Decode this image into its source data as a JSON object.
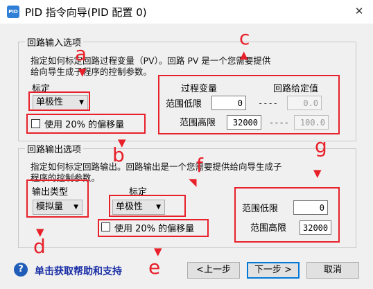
{
  "window": {
    "title": "PID 指令向导(PID 配置 0)",
    "app_icon_text": "PID",
    "close_glyph": "✕"
  },
  "input_section": {
    "title": "回路输入选项",
    "description_line1": "指定如何标定回路过程变量（PV）。回路 PV 是一个您需要提供",
    "description_line2": "给向导生成子程序的控制参数。",
    "scale_label": "标定",
    "scale_value": "单极性",
    "offset_checkbox_label": "使用 20% 的偏移量",
    "offset_checked": false,
    "pv_header": "过程变量",
    "setpoint_header": "回路给定值",
    "low_label": "范围低限",
    "high_label": "范围高限",
    "pv_low": "0",
    "pv_high": "32000",
    "sp_low": "0.0",
    "sp_high": "100.0",
    "dash_sep": "----"
  },
  "output_section": {
    "title": "回路输出选项",
    "description_line1": "指定如何标定回路输出。回路输出是一个您需要提供给向导生成子",
    "description_line2": "程序的控制参数。",
    "type_label": "输出类型",
    "type_value": "模拟量",
    "scale_label": "标定",
    "scale_value": "单极性",
    "offset_checkbox_label": "使用 20% 的偏移量",
    "offset_checked": false,
    "low_label": "范围低限",
    "high_label": "范围高限",
    "low_value": "0",
    "high_value": "32000"
  },
  "annotations": {
    "a": "a",
    "b": "b",
    "c": "c",
    "d": "d",
    "e": "e",
    "f": "f",
    "g": "g"
  },
  "footer": {
    "help_icon_text": "?",
    "help_link": "单击获取帮助和支持",
    "prev_button": "<上一步",
    "next_button": "下一步 >",
    "cancel_button": "取消"
  },
  "colors": {
    "annotation": "#e8202a",
    "link": "#1a2fa6",
    "accent": "#0078d7"
  }
}
